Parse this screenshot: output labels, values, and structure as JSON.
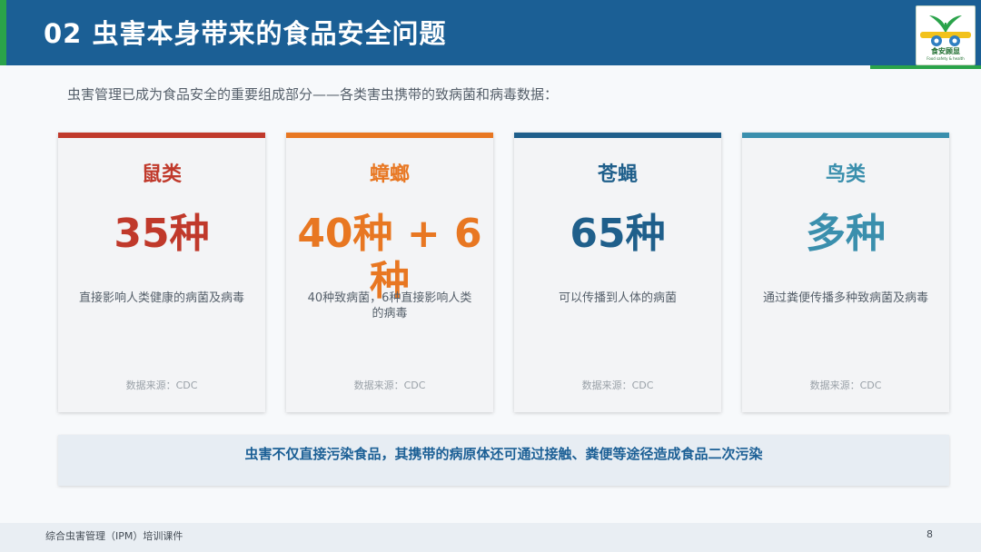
{
  "header": {
    "title": "02  虫害本身带来的食品安全问题",
    "logo_text": "食安顾显",
    "logo_subtext": "Food safety & health",
    "accent_color": "#1b5f95",
    "green_color": "#2aa34a"
  },
  "subtitle": "虫害管理已成为食品安全的重要组成部分——各类害虫携带的致病菌和病毒数据：",
  "cards": [
    {
      "title": "鼠类",
      "value": "35种",
      "description": "直接影响人类健康的病菌及病毒",
      "source": "数据来源：CDC",
      "color": "#c0392b"
    },
    {
      "title": "蟑螂",
      "value": "40种 + 6种",
      "description": "40种致病菌，6种直接影响人类的病毒",
      "source": "数据来源：CDC",
      "color": "#e87722"
    },
    {
      "title": "苍蝇",
      "value": "65种",
      "description": "可以传播到人体的病菌",
      "source": "数据来源：CDC",
      "color": "#1f5f8b"
    },
    {
      "title": "鸟类",
      "value": "多种",
      "description": "通过粪便传播多种致病菌及病毒",
      "source": "数据来源：CDC",
      "color": "#3a8fad"
    }
  ],
  "callout": "虫害不仅直接污染食品，其携带的病原体还可通过接触、粪便等途径造成食品二次污染",
  "footer": {
    "text": "综合虫害管理（IPM）培训课件",
    "page_number": "8"
  }
}
